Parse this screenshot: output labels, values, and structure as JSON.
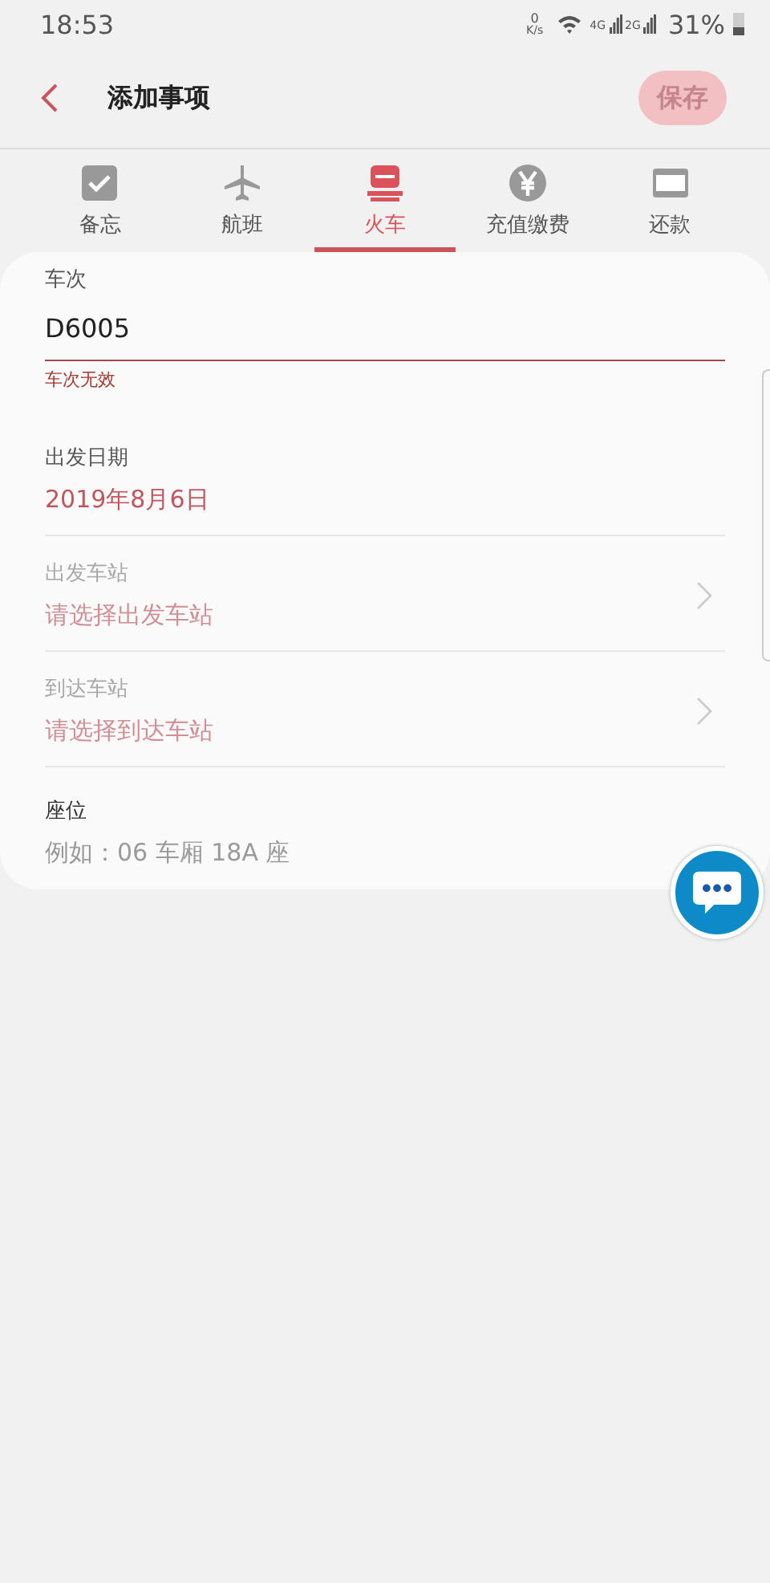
{
  "status_bar": {
    "time": "18:53",
    "net_speed_value": "0",
    "net_speed_unit": "K/s",
    "network_1": "4G",
    "network_2": "2G",
    "battery": "31%"
  },
  "header": {
    "title": "添加事项",
    "save_button": {
      "label": "保存",
      "disabled": true
    }
  },
  "tabs": [
    {
      "kind": "memo",
      "label": "备忘",
      "selected": false
    },
    {
      "kind": "flight",
      "label": "航班",
      "selected": false
    },
    {
      "kind": "train",
      "label": "火车",
      "selected": true
    },
    {
      "kind": "bill",
      "label": "充值缴费",
      "selected": false
    },
    {
      "kind": "repay",
      "label": "还款",
      "selected": false
    }
  ],
  "fields": [
    {
      "kind": "text_input",
      "label": "车次",
      "value": "D6005",
      "error": "车次无效"
    },
    {
      "kind": "date",
      "label": "出发日期",
      "value": "2019年8月6日"
    },
    {
      "kind": "picker",
      "label": "出发车站",
      "placeholder": "请选择出发车站",
      "disabled": true
    },
    {
      "kind": "picker",
      "label": "到达车站",
      "placeholder": "请选择到达车站",
      "disabled": true
    },
    {
      "kind": "input",
      "label": "座位",
      "placeholder": "例如：06 车厢 18A 座"
    }
  ]
}
